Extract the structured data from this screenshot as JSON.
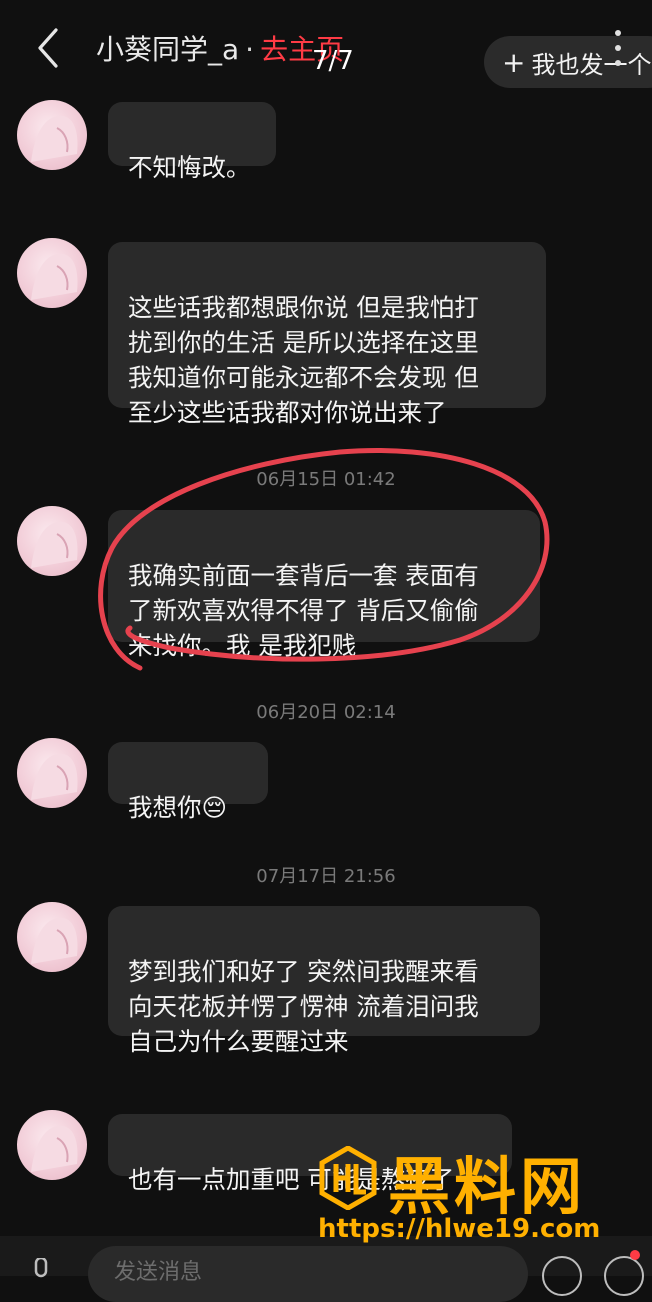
{
  "header": {
    "title": "小葵同学_a",
    "separator": "·",
    "profile_link": "去主页",
    "counter": "7/7",
    "post_button_plus": "+",
    "post_button_label": "我也发一个"
  },
  "messages": [
    {
      "text": "不知悔改。"
    },
    {
      "text": "这些话我都想跟你说 但是我怕打\n扰到你的生活 是所以选择在这里\n我知道你可能永远都不会发现 但\n至少这些话我都对你说出来了"
    },
    {
      "time": "06月15日 01:42",
      "text": "我确实前面一套背后一套 表面有\n了新欢喜欢得不得了 背后又偷偷\n来找你。我 是我犯贱"
    },
    {
      "time": "06月20日 02:14",
      "text": "我想你",
      "emoji": "😔"
    },
    {
      "time": "07月17日 21:56",
      "text": "梦到我们和好了 突然间我醒来看\n向天花板并愣了愣神 流着泪问我\n自己为什么要醒过来"
    },
    {
      "text": "也有一点加重吧 可能是熬夜了"
    }
  ],
  "annotation_color": "#e6424e",
  "watermark": {
    "title": "黑料网",
    "url": "https://hlwe19.com",
    "color": "#ffb000"
  },
  "input": {
    "placeholder": "发送消息"
  },
  "icons": [
    "back-icon",
    "more-icon",
    "mic-icon",
    "emoji-icon",
    "add-icon"
  ]
}
